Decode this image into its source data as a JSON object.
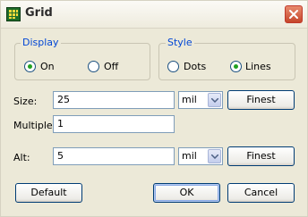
{
  "window": {
    "title": "Grid"
  },
  "display": {
    "label": "Display",
    "on_label": "On",
    "off_label": "Off",
    "selected": "On"
  },
  "style": {
    "label": "Style",
    "dots_label": "Dots",
    "lines_label": "Lines",
    "selected": "Lines"
  },
  "size": {
    "label": "Size:",
    "value": "25",
    "unit": "mil",
    "button": "Finest"
  },
  "multiple": {
    "label": "Multiple:",
    "value": "1"
  },
  "alt": {
    "label": "Alt:",
    "value": "5",
    "unit": "mil",
    "button": "Finest"
  },
  "buttons": {
    "default": "Default",
    "ok": "OK",
    "cancel": "Cancel"
  },
  "icons": {
    "app": "grid-app-icon",
    "close": "close-icon",
    "dropdown": "chevron-down-icon"
  },
  "colors": {
    "group_label": "#0046d5",
    "radio_dot": "#21a121",
    "close_button": "#c5452a"
  }
}
